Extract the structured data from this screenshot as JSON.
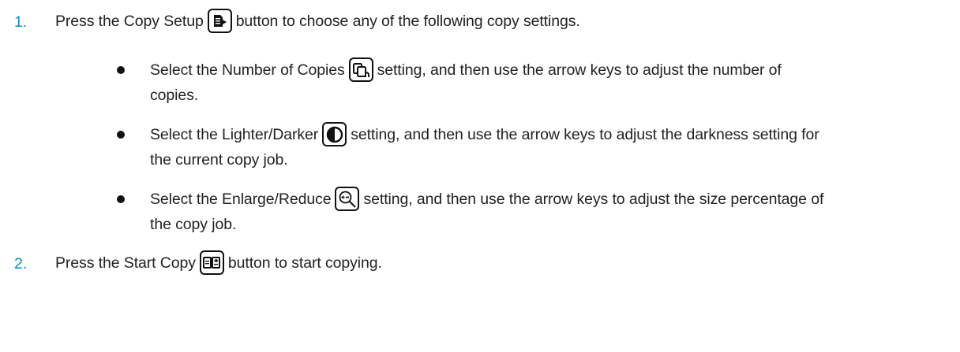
{
  "steps": [
    {
      "number": "1.",
      "before": "Press the Copy Setup",
      "icon": "copy-setup-icon",
      "after": "button to choose any of the following copy settings.",
      "bullets": [
        {
          "before": "Select the Number of Copies",
          "icon": "number-of-copies-icon",
          "after": "setting, and then use the arrow keys to adjust the number of",
          "continuation": "copies."
        },
        {
          "before": "Select the Lighter/Darker",
          "icon": "lighter-darker-icon",
          "after": "setting, and then use the arrow keys to adjust the darkness setting for",
          "continuation": "the current copy job."
        },
        {
          "before": "Select the Enlarge/Reduce",
          "icon": "enlarge-reduce-icon",
          "after": "setting, and then use the arrow keys to adjust the size percentage of",
          "continuation": "the copy job."
        }
      ]
    },
    {
      "number": "2.",
      "before": "Press the Start Copy",
      "icon": "start-copy-icon",
      "after": "button to start copying."
    }
  ],
  "colors": {
    "step_number": "#0a8bc6",
    "text": "#222222"
  }
}
